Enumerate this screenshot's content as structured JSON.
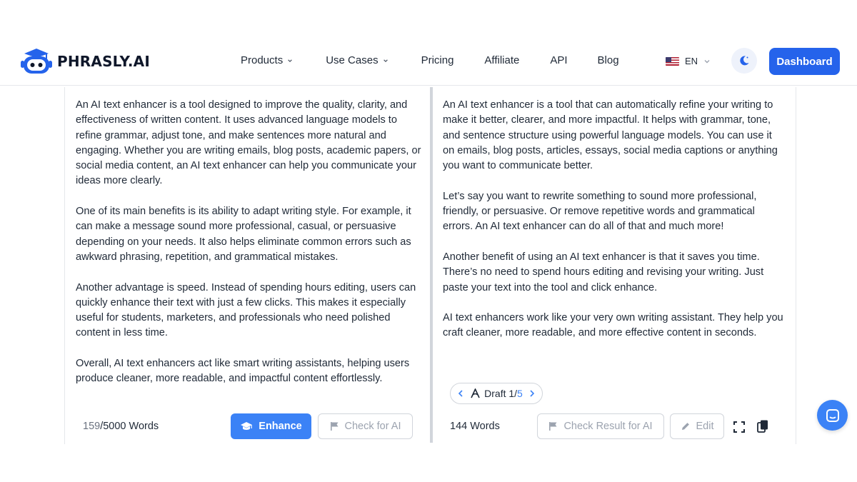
{
  "brand": {
    "name": "PHRASLY.AI",
    "accent": "#2563eb"
  },
  "nav": {
    "items": [
      {
        "label": "Products",
        "has_dropdown": true
      },
      {
        "label": "Use Cases",
        "has_dropdown": true
      },
      {
        "label": "Pricing",
        "has_dropdown": false
      },
      {
        "label": "Affiliate",
        "has_dropdown": false
      },
      {
        "label": "API",
        "has_dropdown": false
      },
      {
        "label": "Blog",
        "has_dropdown": false
      }
    ],
    "language": "EN",
    "theme_icon": "moon-icon",
    "dashboard_label": "Dashboard"
  },
  "input_panel": {
    "paragraphs": [
      "An AI text enhancer is a tool designed to improve the quality, clarity, and effectiveness of written content. It uses advanced language models to refine grammar, adjust tone, and make sentences more natural and engaging. Whether you are writing emails, blog posts, academic papers, or social media content, an AI text enhancer can help you communicate your ideas more clearly.",
      "One of its main benefits is its ability to adapt writing style. For example, it can make a message sound more professional, casual, or persuasive depending on your needs. It also helps eliminate common errors such as awkward phrasing, repetition, and grammatical mistakes.",
      "Another advantage is speed. Instead of spending hours editing, users can quickly enhance their text with just a few clicks. This makes it especially useful for students, marketers, and professionals who need polished content in less time.",
      "Overall, AI text enhancers act like smart writing assistants, helping users produce cleaner, more readable, and impactful content effortlessly."
    ],
    "word_count_used": "159",
    "word_count_limit": "/5000 Words",
    "enhance_label": "Enhance",
    "check_ai_label": "Check for AI"
  },
  "output_panel": {
    "paragraphs": [
      "An AI text enhancer is a tool that can automatically refine your writing to make it better, clearer, and more impactful. It helps with grammar, tone, and sentence structure using powerful language models. You can use it on emails, blog posts, articles, essays, social media captions or anything you want to communicate better.",
      "Let’s say you want to rewrite something to sound more professional, friendly, or persuasive. Or remove repetitive words and grammatical errors. An AI text enhancer can do all of that and much more!",
      "Another benefit of using an AI text enhancer is that it saves you time. There’s no need to spend hours editing and revising your writing. Just paste your text into the tool and click enhance.",
      "AI text enhancers work like your very own writing assistant. They help you craft cleaner, more readable, and more effective content in seconds."
    ],
    "draft_label": "Draft 1/",
    "draft_total": "5",
    "word_count": "144 Words",
    "check_result_label": "Check Result for AI",
    "edit_label": "Edit"
  },
  "icons": {
    "theme": "moon-icon",
    "enhance": "graduation-cap-icon",
    "flag": "flag-icon",
    "edit": "pencil-icon",
    "fullscreen": "expand-icon",
    "copy": "copy-icon",
    "chat": "chat-icon"
  }
}
